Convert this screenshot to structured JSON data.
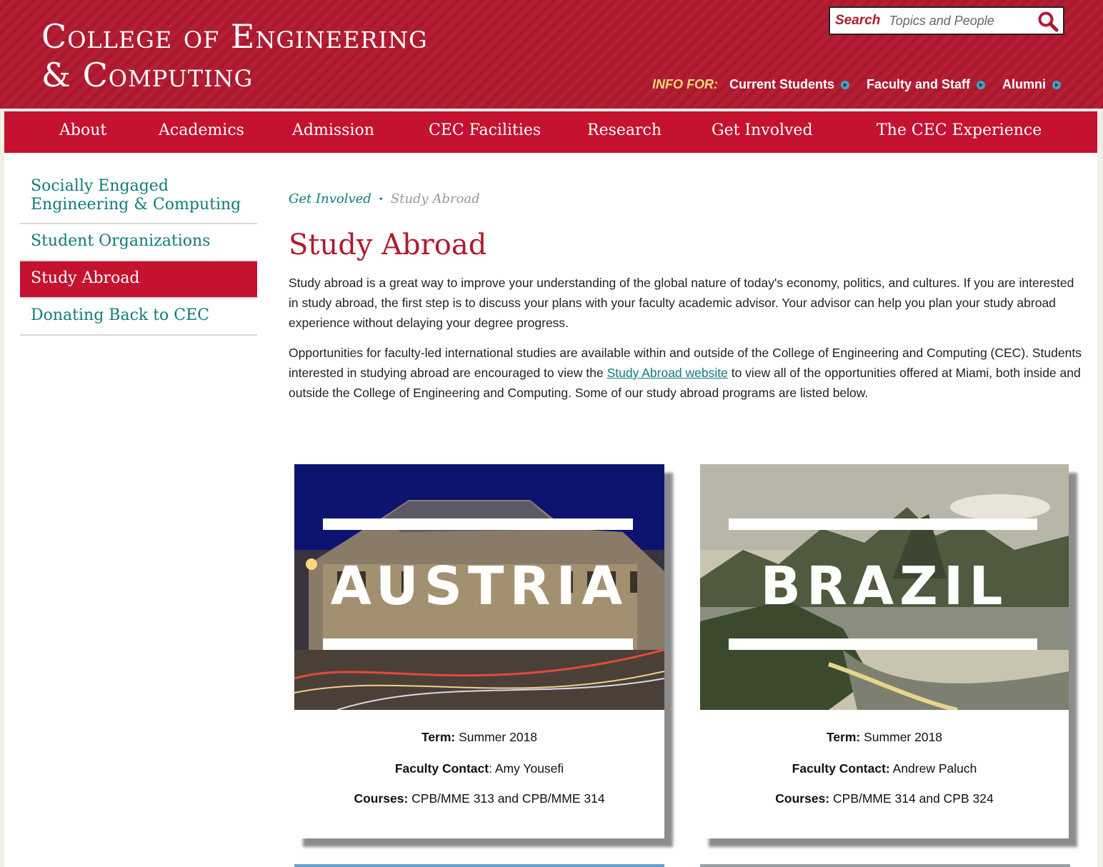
{
  "header": {
    "title_line1": "College of Engineering",
    "title_line2": "& Computing",
    "search": {
      "label": "Search",
      "placeholder": "Topics and People"
    },
    "info_for": {
      "label": "INFO FOR:",
      "links": [
        "Current Students",
        "Faculty and Staff",
        "Alumni"
      ]
    }
  },
  "nav": [
    "About",
    "Academics",
    "Admission",
    "CEC Facilities",
    "Research",
    "Get Involved",
    "The CEC Experience"
  ],
  "sidebar": {
    "items": [
      {
        "label_line1": "Socially Engaged",
        "label_line2": "Engineering & Computing"
      },
      {
        "label": "Student Organizations"
      },
      {
        "label": "Study Abroad"
      },
      {
        "label": "Donating Back to CEC"
      }
    ]
  },
  "breadcrumb": {
    "parent": "Get Involved",
    "sep": "•",
    "current": "Study Abroad"
  },
  "page_title": "Study Abroad",
  "para1": "Study abroad is a great way to improve your understanding of the global nature of today's economy, politics, and cultures. If you are interested in study abroad, the first step is to discuss your plans with your faculty academic advisor. Your advisor can help you plan your study abroad experience without delaying your degree progress.",
  "para2": {
    "before": "Opportunities for faculty-led international studies are available within and outside of the College of Engineering and Computing (CEC). Students interested in studying abroad are encouraged to view the ",
    "link": "Study Abroad website",
    "after": " to view all of the opportunities offered at Miami, both inside and outside the College of Engineering and Computing. Some of our study abroad programs are listed below."
  },
  "cards": [
    {
      "country": "AUSTRIA",
      "term_label": "Term:",
      "term": " Summer 2018",
      "contact_label": "Faculty Contact",
      "contact": ": Amy Yousefi",
      "courses_label": "Courses:",
      "courses": " CPB/MME 313 and CPB/MME 314"
    },
    {
      "country": "BRAZIL",
      "term_label": "Term:",
      "term": " Summer 2018",
      "contact_label": "Faculty Contact:",
      "contact": " Andrew Paluch",
      "courses_label": "Courses:",
      "courses": " CPB/MME 314 and CPB 324"
    }
  ]
}
